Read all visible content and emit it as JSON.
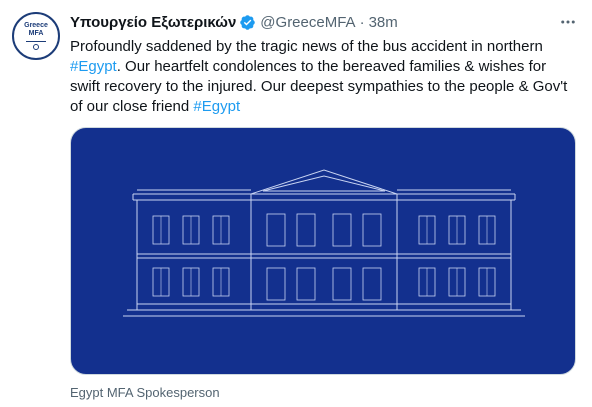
{
  "account": {
    "display_name": "Υπουργείο Εξωτερικών",
    "handle": "@GreeceMFA",
    "separator": "·",
    "time_ago": "38m",
    "avatar_line1": "Greece",
    "avatar_line2": "MFA"
  },
  "tweet": {
    "text_1": "Profoundly saddened by the tragic news of the bus accident in northern ",
    "hashtag_1": "#Egypt",
    "text_2": ". Our heartfelt condolences to the bereaved families & wishes for swift recovery to the injured. Our deepest sympathies to the people & Gov't of our close friend ",
    "hashtag_2": "#Egypt"
  },
  "media": {
    "caption": "Egypt MFA Spokesperson",
    "background_color": "#13308e",
    "line_color": "#c9d4f2"
  },
  "colors": {
    "link": "#1d9bf0",
    "verified": "#1d9bf0",
    "secondary_text": "#536471"
  },
  "icons": {
    "verified": "verified-badge-icon",
    "more": "more-horizontal-icon"
  }
}
